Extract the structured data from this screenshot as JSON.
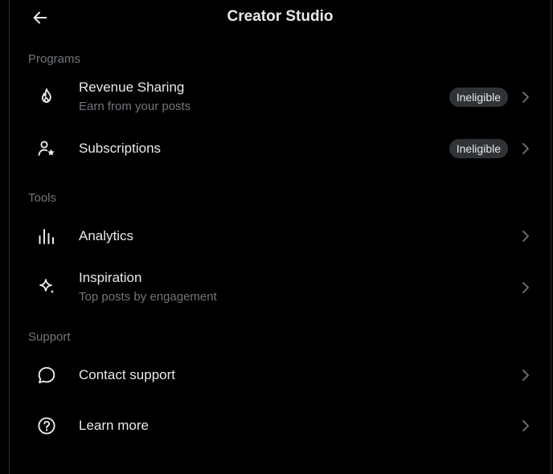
{
  "header": {
    "title": "Creator Studio",
    "back_icon": "arrow-left-icon"
  },
  "sections": {
    "programs": "Programs",
    "tools": "Tools",
    "support": "Support"
  },
  "items": {
    "revenue_sharing": {
      "label": "Revenue Sharing",
      "sub": "Earn from your posts",
      "badge": "Ineligible",
      "icon": "flame-icon"
    },
    "subscriptions": {
      "label": "Subscriptions",
      "badge": "Ineligible",
      "icon": "person-star-icon"
    },
    "analytics": {
      "label": "Analytics",
      "icon": "bar-chart-icon"
    },
    "inspiration": {
      "label": "Inspiration",
      "sub": "Top posts by engagement",
      "icon": "sparkle-icon"
    },
    "contact_support": {
      "label": "Contact support",
      "icon": "chat-bubble-icon"
    },
    "learn_more": {
      "label": "Learn more",
      "icon": "question-circle-icon"
    }
  },
  "colors": {
    "background": "#000000",
    "text": "#e7e9ea",
    "secondary": "#71767b",
    "badge_bg": "#2f3336"
  }
}
